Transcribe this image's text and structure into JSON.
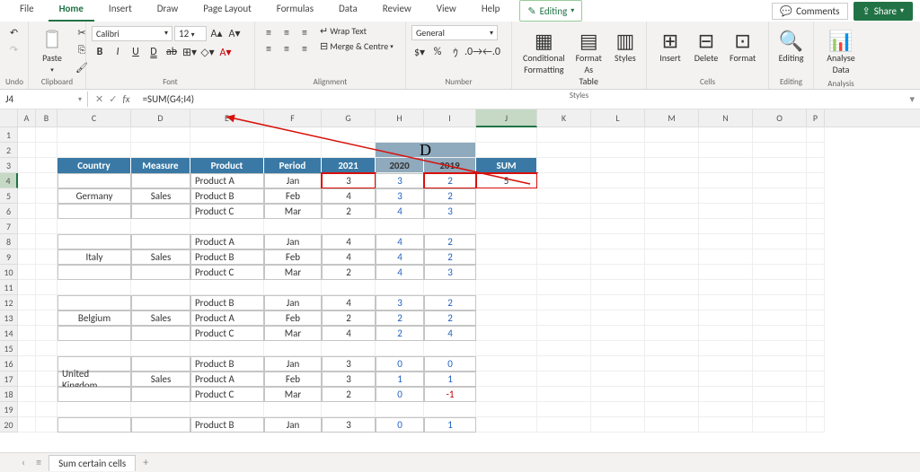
{
  "menu": {
    "items": [
      "File",
      "Home",
      "Insert",
      "Draw",
      "Page Layout",
      "Formulas",
      "Data",
      "Review",
      "View",
      "Help"
    ],
    "editing": "Editing",
    "comments": "Comments",
    "share": "Share"
  },
  "ribbon": {
    "undo": "Undo",
    "clipboard": {
      "paste": "Paste",
      "label": "Clipboard"
    },
    "font": {
      "name": "Calibri",
      "size": "12",
      "label": "Font"
    },
    "alignment": {
      "wrap": "Wrap Text",
      "merge": "Merge & Centre",
      "label": "Alignment"
    },
    "number": {
      "format": "General",
      "label": "Number"
    },
    "styles": {
      "cond": "Conditional Formatting",
      "fmtas": "Format As Table",
      "styl": "Styles",
      "label": "Styles"
    },
    "cells": {
      "insert": "Insert",
      "delete": "Delete",
      "format": "Format",
      "label": "Cells"
    },
    "editing": {
      "label": "Editing",
      "btn": "Editing"
    },
    "analysis": {
      "btn": "Analyse Data",
      "label": "Analysis"
    }
  },
  "namebox": "J4",
  "formula": "=SUM(G4;I4)",
  "cols": {
    "A": 20,
    "B": 24,
    "C": 82,
    "D": 66,
    "E": 82,
    "F": 64,
    "G": 60,
    "H": 54,
    "I": 58,
    "J": 68,
    "K": 60,
    "L": 60,
    "M": 60,
    "N": 60,
    "O": 60,
    "P": 20
  },
  "titleD": "D",
  "hdr": [
    "Country",
    "Measure",
    "Product",
    "Period",
    "2021",
    "2020",
    "2019",
    "SUM"
  ],
  "data": [
    {
      "country": "Germany",
      "measure": "Sales",
      "rows": [
        [
          "Product A",
          "Jan",
          "3",
          "3",
          "2",
          "5"
        ],
        [
          "Product B",
          "Feb",
          "4",
          "3",
          "2",
          ""
        ],
        [
          "Product C",
          "Mar",
          "2",
          "4",
          "3",
          ""
        ]
      ]
    },
    {
      "country": "Italy",
      "measure": "Sales",
      "rows": [
        [
          "Product A",
          "Jan",
          "4",
          "4",
          "2",
          ""
        ],
        [
          "Product B",
          "Feb",
          "4",
          "4",
          "2",
          ""
        ],
        [
          "Product C",
          "Mar",
          "2",
          "4",
          "3",
          ""
        ]
      ]
    },
    {
      "country": "Belgium",
      "measure": "Sales",
      "rows": [
        [
          "Product B",
          "Jan",
          "4",
          "3",
          "2",
          ""
        ],
        [
          "Product A",
          "Feb",
          "2",
          "2",
          "2",
          ""
        ],
        [
          "Product C",
          "Mar",
          "4",
          "2",
          "4",
          ""
        ]
      ]
    },
    {
      "country": "United Kingdom",
      "measure": "Sales",
      "rows": [
        [
          "Product B",
          "Jan",
          "3",
          "0",
          "0",
          ""
        ],
        [
          "Product A",
          "Feb",
          "3",
          "1",
          "1",
          ""
        ],
        [
          "Product C",
          "Mar",
          "2",
          "0",
          "-1",
          ""
        ]
      ]
    },
    {
      "country": "",
      "measure": "",
      "rows": [
        [
          "Product B",
          "Jan",
          "3",
          "0",
          "1",
          ""
        ]
      ]
    }
  ],
  "sheetTab": "Sum certain cells",
  "chart_data": {
    "type": "table",
    "title": "Sum certain cells",
    "columns": [
      "Country",
      "Measure",
      "Product",
      "Period",
      "2021",
      "2020",
      "2019",
      "SUM"
    ],
    "rows": [
      [
        "Germany",
        "Sales",
        "Product A",
        "Jan",
        3,
        3,
        2,
        5
      ],
      [
        "Germany",
        "Sales",
        "Product B",
        "Feb",
        4,
        3,
        2,
        null
      ],
      [
        "Germany",
        "Sales",
        "Product C",
        "Mar",
        2,
        4,
        3,
        null
      ],
      [
        "Italy",
        "Sales",
        "Product A",
        "Jan",
        4,
        4,
        2,
        null
      ],
      [
        "Italy",
        "Sales",
        "Product B",
        "Feb",
        4,
        4,
        2,
        null
      ],
      [
        "Italy",
        "Sales",
        "Product C",
        "Mar",
        2,
        4,
        3,
        null
      ],
      [
        "Belgium",
        "Sales",
        "Product B",
        "Jan",
        4,
        3,
        2,
        null
      ],
      [
        "Belgium",
        "Sales",
        "Product A",
        "Feb",
        2,
        2,
        2,
        null
      ],
      [
        "Belgium",
        "Sales",
        "Product C",
        "Mar",
        4,
        2,
        4,
        null
      ],
      [
        "United Kingdom",
        "Sales",
        "Product B",
        "Jan",
        3,
        0,
        0,
        null
      ],
      [
        "United Kingdom",
        "Sales",
        "Product A",
        "Feb",
        3,
        1,
        1,
        null
      ],
      [
        "United Kingdom",
        "Sales",
        "Product C",
        "Mar",
        2,
        0,
        -1,
        null
      ]
    ]
  }
}
